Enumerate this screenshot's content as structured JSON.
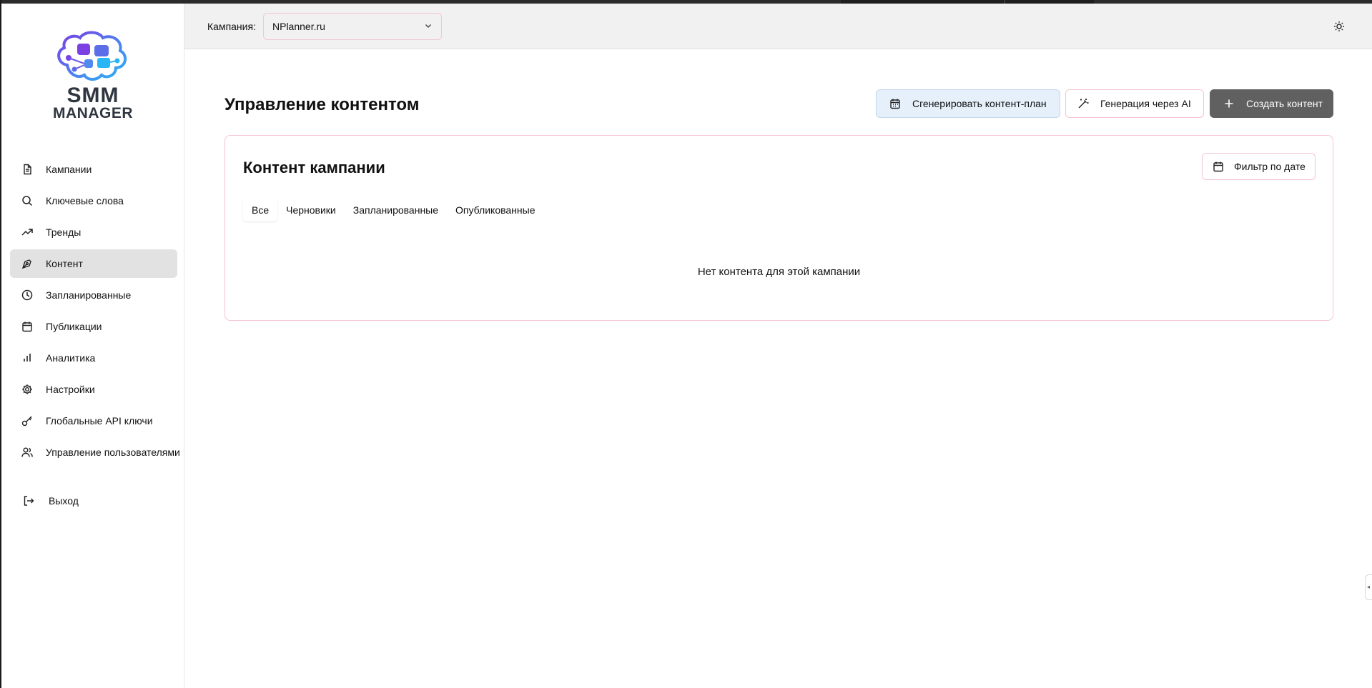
{
  "brand": {
    "line1": "SMM",
    "line2": "MANAGER"
  },
  "sidebar": {
    "items": [
      {
        "label": "Кампании",
        "icon": "document-icon",
        "active": false
      },
      {
        "label": "Ключевые слова",
        "icon": "search-icon",
        "active": false
      },
      {
        "label": "Тренды",
        "icon": "trending-up-icon",
        "active": false
      },
      {
        "label": "Контент",
        "icon": "pen-tool-icon",
        "active": true
      },
      {
        "label": "Запланированные",
        "icon": "clock-icon",
        "active": false
      },
      {
        "label": "Публикации",
        "icon": "calendar-icon",
        "active": false
      },
      {
        "label": "Аналитика",
        "icon": "bar-chart-icon",
        "active": false
      },
      {
        "label": "Настройки",
        "icon": "gear-icon",
        "active": false
      },
      {
        "label": "Глобальные API ключи",
        "icon": "key-icon",
        "active": false
      },
      {
        "label": "Управление пользователями",
        "icon": "users-icon",
        "active": false
      }
    ],
    "logout_label": "Выход"
  },
  "header": {
    "campaign_label": "Кампания:",
    "campaign_selected": "NPlanner.ru"
  },
  "main": {
    "title": "Управление контентом",
    "actions": {
      "generate_plan": "Сгенерировать контент-план",
      "ai_generate": "Генерация через AI",
      "create": "Создать контент"
    },
    "card": {
      "title": "Контент кампании",
      "filter_label": "Фильтр по дате",
      "tabs": [
        {
          "label": "Все",
          "active": true
        },
        {
          "label": "Черновики",
          "active": false
        },
        {
          "label": "Запланированные",
          "active": false
        },
        {
          "label": "Опубликованные",
          "active": false
        }
      ],
      "empty_message": "Нет контента для этой кампании"
    }
  },
  "colors": {
    "accent_border": "#f4c6d0",
    "primary_button": "#606060",
    "secondary_button_bg": "#e6f0fb",
    "active_nav_bg": "#e2e2e2"
  }
}
